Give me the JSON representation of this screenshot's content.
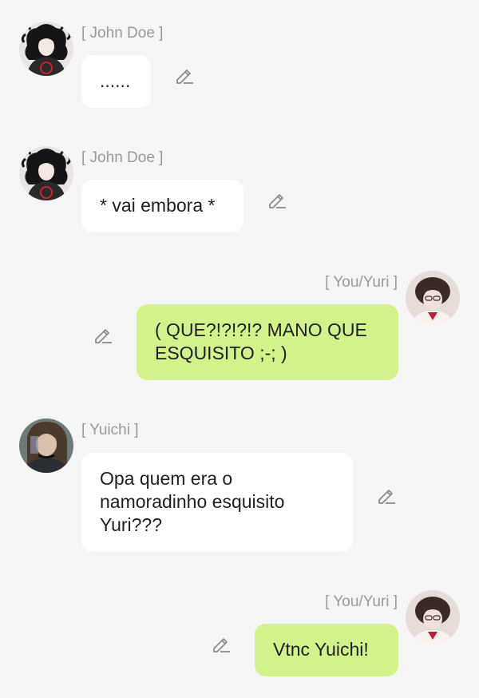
{
  "colors": {
    "background": "#f5f5f5",
    "incoming_bubble": "#ffffff",
    "outgoing_bubble": "#d4f28c",
    "name_text": "#9a9a9a",
    "message_text": "#1f1f1f",
    "edit_icon": "#8c8c8c"
  },
  "messages": [
    {
      "direction": "incoming",
      "sender": "[ John Doe ]",
      "text": "......",
      "avatar": "john-doe-avatar",
      "icon": "pencil-icon"
    },
    {
      "direction": "incoming",
      "sender": "[ John Doe ]",
      "text": "* vai embora *",
      "avatar": "john-doe-avatar",
      "icon": "pencil-icon"
    },
    {
      "direction": "outgoing",
      "sender": "[ You/Yuri ]",
      "text": "( QUE?!?!?!? MANO QUE\nESQUISITO ;-; )",
      "avatar": "yuri-avatar",
      "icon": "pencil-icon"
    },
    {
      "direction": "incoming",
      "sender": "[ Yuichi ]",
      "text": "Opa quem era o\nnamoradinho esquisito\nYuri???",
      "avatar": "yuichi-avatar",
      "icon": "pencil-icon"
    },
    {
      "direction": "outgoing",
      "sender": "[ You/Yuri ]",
      "text": "Vtnc Yuichi!",
      "avatar": "yuri-avatar",
      "icon": "pencil-icon"
    }
  ]
}
